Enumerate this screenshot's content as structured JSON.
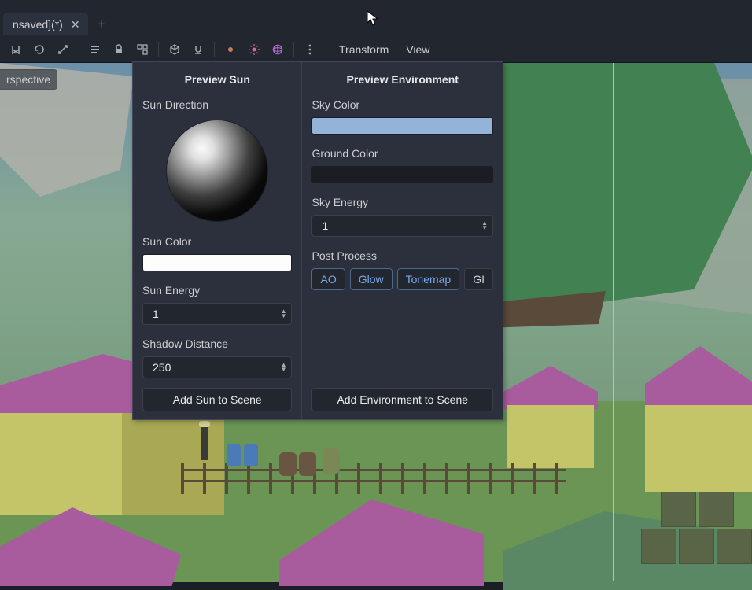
{
  "tab": {
    "title": "nsaved](*)"
  },
  "toolbar": {
    "menus": {
      "transform": "Transform",
      "view": "View"
    }
  },
  "viewport": {
    "projection_label": "rspective"
  },
  "preview_sun": {
    "title": "Preview Sun",
    "direction_label": "Sun Direction",
    "color_label": "Sun Color",
    "color_value": "#ffffff",
    "energy_label": "Sun Energy",
    "energy_value": "1",
    "shadow_label": "Shadow Distance",
    "shadow_value": "250",
    "add_button": "Add Sun to Scene"
  },
  "preview_env": {
    "title": "Preview Environment",
    "sky_color_label": "Sky Color",
    "sky_color_value": "#93b3d9",
    "ground_color_label": "Ground Color",
    "ground_color_value": "#1b1d22",
    "sky_energy_label": "Sky Energy",
    "sky_energy_value": "1",
    "post_process_label": "Post Process",
    "toggles": {
      "ao": "AO",
      "glow": "Glow",
      "tonemap": "Tonemap",
      "gi": "GI"
    },
    "add_button": "Add Environment to Scene"
  }
}
